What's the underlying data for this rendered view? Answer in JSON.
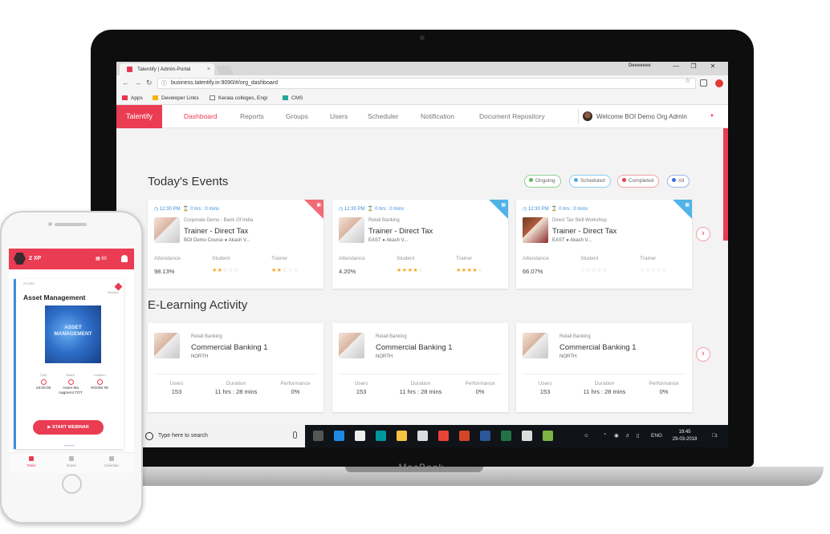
{
  "browser": {
    "tab_title": "Talentify | Admin-Portal",
    "tab_close": "×",
    "window_user": "Deeeeeee",
    "window_controls": [
      "—",
      "❐",
      "✕"
    ],
    "url": "business.talentify.in:9090/#/org_dashboard",
    "bookmarks": [
      {
        "label": "Apps",
        "color": "#e8384f"
      },
      {
        "label": "Developer Links",
        "color": "#f4b400"
      },
      {
        "label": "Kerala colleges, Engi",
        "color": "#777777"
      },
      {
        "label": "CMS",
        "color": "#26a69a"
      }
    ]
  },
  "app": {
    "brand": "Talentify",
    "accent": "#ea3c53",
    "nav": [
      "Dashboard",
      "Reports",
      "Groups",
      "Users",
      "Scheduler",
      "Notification",
      "Document Repository"
    ],
    "welcome": "Welcome BOI Demo Org Admin"
  },
  "events": {
    "title": "Today's Events",
    "filters": [
      {
        "label": "Ongoing",
        "color": "#5cb85c"
      },
      {
        "label": "Scheduled",
        "color": "#4fa9e8"
      },
      {
        "label": "Completed",
        "color": "#ea3c53"
      },
      {
        "label": "All",
        "color": "#3a6fe0"
      }
    ],
    "cards": [
      {
        "time": "12:30 PM",
        "duration": "0 hrs : 0 mins",
        "org": "Corporate Demo - Bank Of India",
        "title": "Trainer - Direct Tax",
        "sub": "BOI Demo Course ● Akash V...",
        "corner_color": "#f06b76",
        "corner_icon": "camera-icon",
        "attendance_label": "Attendance",
        "attendance": "98.13%",
        "student_label": "Student",
        "student_rating": 2,
        "trainer_label": "Trainer",
        "trainer_rating": 2
      },
      {
        "time": "12:30 PM",
        "duration": "0 hrs : 0 mins",
        "org": "Retail Banking",
        "title": "Trainer - Direct Tax",
        "sub": "EAST ● Akash V...",
        "corner_color": "#4fb3e8",
        "corner_icon": "calendar-icon",
        "attendance_label": "Attendance",
        "attendance": "4.20%",
        "student_label": "Student",
        "student_rating": 4,
        "trainer_label": "Trainer",
        "trainer_rating": 4
      },
      {
        "time": "12:30 PM",
        "duration": "0 hrs : 0 mins",
        "org": "Direct Tax Skill Workshop",
        "title": "Trainer - Direct Tax",
        "sub": "EAST ● Akash V...",
        "corner_color": "#4fb3e8",
        "corner_icon": "calendar-icon",
        "attendance_label": "Attendance",
        "attendance": "66.07%",
        "student_label": "Student",
        "student_rating": 0,
        "trainer_label": "Trainer",
        "trainer_rating": 0
      }
    ]
  },
  "elearning": {
    "title": "E-Learning Activity",
    "cards": [
      {
        "org": "Retail Banking",
        "title": "Commercial Banking 1",
        "region": "NORTH",
        "users_label": "Users",
        "users": "153",
        "duration_label": "Duration",
        "duration": "11 hrs : 28 mins",
        "performance_label": "Performance",
        "performance": "0%"
      },
      {
        "org": "Retail Banking",
        "title": "Commercial Banking 1",
        "region": "NORTH",
        "users_label": "Users",
        "users": "153",
        "duration_label": "Duration",
        "duration": "11 hrs : 28 mins",
        "performance_label": "Performance",
        "performance": "0%"
      },
      {
        "org": "Retail Banking",
        "title": "Commercial Banking 1",
        "region": "NORTH",
        "users_label": "Users",
        "users": "153",
        "duration_label": "Duration",
        "duration": "11 hrs : 28 mins",
        "performance_label": "Performance",
        "performance": "0%"
      }
    ]
  },
  "taskbar": {
    "search_placeholder": "Type here to search",
    "apps": [
      {
        "name": "task-view",
        "color": "#555555"
      },
      {
        "name": "edge",
        "color": "#1e88e5"
      },
      {
        "name": "store",
        "color": "#eeeeee"
      },
      {
        "name": "arduino",
        "color": "#00979d"
      },
      {
        "name": "explorer",
        "color": "#f6c343"
      },
      {
        "name": "mail",
        "color": "#dddddd"
      },
      {
        "name": "chrome",
        "color": "#ea4335"
      },
      {
        "name": "powerpoint",
        "color": "#d24726"
      },
      {
        "name": "word",
        "color": "#2b579a"
      },
      {
        "name": "excel",
        "color": "#217346"
      },
      {
        "name": "photos",
        "color": "#dddddd"
      },
      {
        "name": "paint",
        "color": "#7cb342"
      }
    ],
    "lang": "ENG",
    "time": "19:45",
    "date": "29-03-2018",
    "notifications": "1"
  },
  "laptop": {
    "label": "MacBook"
  },
  "phone": {
    "xp": "2 XP",
    "count": "60",
    "small_label": "SCORE",
    "title": "Asset Management",
    "diamond_label": "Direction",
    "art_text": "ASSET MANAGEMENT",
    "info": [
      {
        "label": "Time",
        "value": "19:00:00"
      },
      {
        "label": "Batch",
        "value": "Asset Ma nagment TOT"
      },
      {
        "label": "Location",
        "value": "ROOM #5"
      }
    ],
    "button": "START WEBINAR",
    "dots": "•••••",
    "tabs": [
      "Tasks",
      "Notes",
      "Calendar"
    ]
  }
}
